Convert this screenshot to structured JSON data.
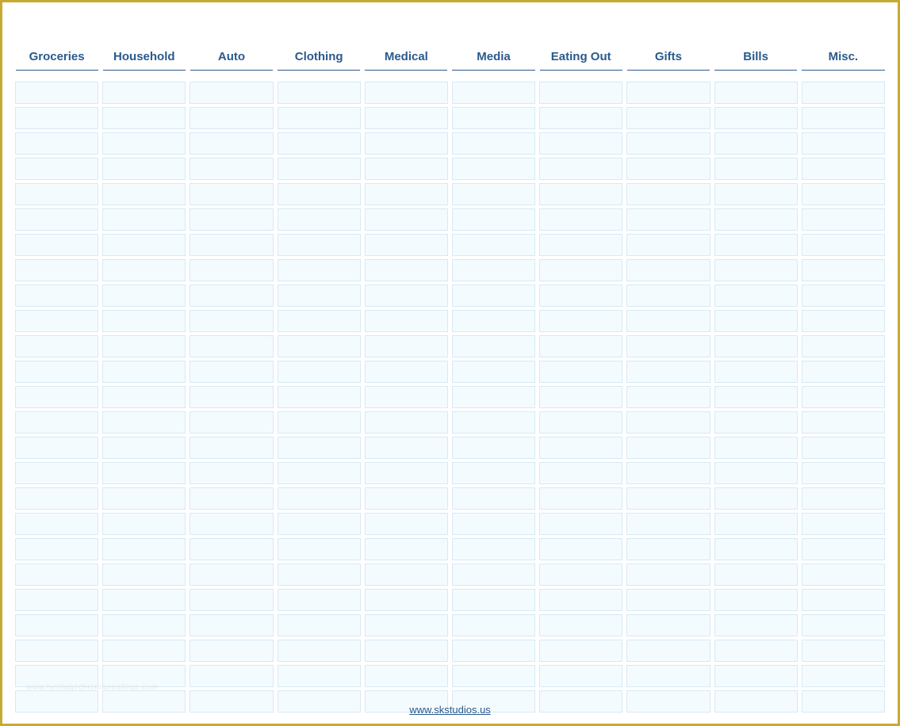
{
  "sheet": {
    "columns": [
      "Groceries",
      "Household",
      "Auto",
      "Clothing",
      "Medical",
      "Media",
      "Eating Out",
      "Gifts",
      "Bills",
      "Misc."
    ],
    "row_count": 25
  },
  "footer": {
    "link_text": "www.skstudios.us",
    "link_href": "http://www.skstudios.us"
  },
  "watermark": "www.heritagechristiancollege.com"
}
